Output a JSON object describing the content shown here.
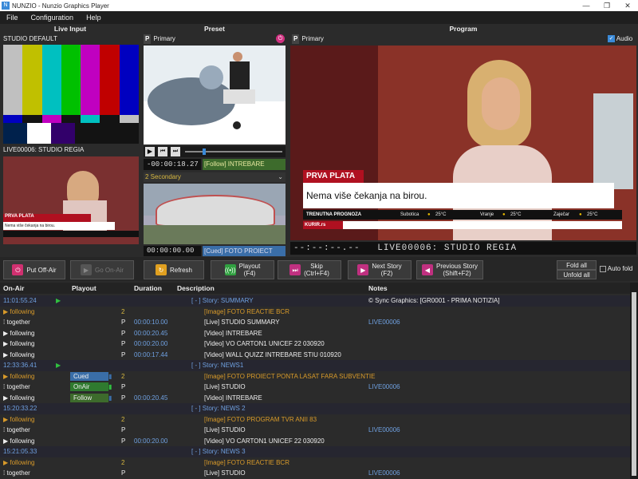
{
  "window": {
    "title": "NUNZIO - Nunzio Graphics Player",
    "minimize": "—",
    "maximize": "❐",
    "close": "✕"
  },
  "menu": [
    "File",
    "Configuration",
    "Help"
  ],
  "columns": {
    "live_input": "Live Input",
    "preset": "Preset",
    "program": "Program"
  },
  "live": {
    "source1": "STUDIO DEFAULT",
    "source2": "LIVE00006: STUDIO REGIA",
    "lower_third_title": "PRVA PLATA",
    "lower_third_text": "Nema više čekanja na birou."
  },
  "preset": {
    "badge": "P",
    "label": "Primary",
    "timecode": "-00:00:18.27",
    "follow_text": "[Follow] INTREBARE",
    "secondary_label": "2 Secondary",
    "timecode2": "00:00:00.00",
    "cued_text": "[Cued] FOTO PROIECT PONTA"
  },
  "program": {
    "badge": "P",
    "label": "Primary",
    "audio_label": "Audio",
    "lower_third_title": "PRVA PLATA",
    "lower_third_text": "Nema više čekanja na birou.",
    "ticker": [
      "TRENUTNA PROGNOZA",
      "Subotica",
      "25°C",
      "Vranje",
      "25°C",
      "Zaječar",
      "25°C"
    ],
    "ticker_site": "KURIR.rs",
    "timecode": "--:--:--.--",
    "live_label": "LIVE00006: STUDIO REGIA"
  },
  "buttons": {
    "put_off_air": "Put Off-Air",
    "go_on_air": "Go On-Air",
    "refresh": "Refresh",
    "playout": "Playout\n(F4)",
    "skip": "Skip\n(Ctrl+F4)",
    "next_story": "Next Story\n(F2)",
    "previous_story": "Previous Story\n(Shift+F2)",
    "fold_all": "Fold all",
    "unfold_all": "Unfold all",
    "auto_fold": "Auto fold"
  },
  "table": {
    "headers": {
      "on_air": "On-Air",
      "playout": "Playout",
      "duration": "Duration",
      "description": "Description",
      "notes": "Notes"
    },
    "rows": [
      {
        "onair": "11:01:55.24",
        "type": "time",
        "play": "▶",
        "pl": "",
        "dur": "",
        "desc": "[ - ] Story: SUMMARY",
        "notes": "© Sync Graphics: [GR0001 - PRIMA NOTIZIA]"
      },
      {
        "onair": "▶ following",
        "type": "orange",
        "pl": "2",
        "dur": "",
        "desc": "[Image] FOTO REACTIE BCR",
        "notes": ""
      },
      {
        "onair": "⁞ together",
        "type": "white",
        "pl": "P",
        "dur": "00:00:10.00",
        "desc": "[Live] STUDIO SUMMARY",
        "notes": "LIVE00006"
      },
      {
        "onair": "▶ following",
        "type": "white",
        "pl": "P",
        "dur": "00:00:20.45",
        "desc": "[Video] INTREBARE",
        "notes": ""
      },
      {
        "onair": "▶ following",
        "type": "white",
        "pl": "P",
        "dur": "00:00:20.00",
        "desc": "[Video] VO CARTON1 UNICEF 22 030920",
        "notes": ""
      },
      {
        "onair": "▶ following",
        "type": "white",
        "pl": "P",
        "dur": "00:00:17.44",
        "desc": "[Video] WALL QUIZZ INTREBARE STIU 010920",
        "notes": ""
      },
      {
        "onair": "12:33:36.41",
        "type": "time",
        "play": "▶",
        "pl": "",
        "dur": "",
        "desc": "[ - ] Story: NEWS1",
        "notes": ""
      },
      {
        "onair": "▶ following",
        "type": "orange",
        "status": "Cued",
        "pl": "2",
        "dur": "",
        "desc": "[Image] FOTO PROIECT PONTA LASAT FARA SUBVENTIE",
        "notes": ""
      },
      {
        "onair": "⁞ together",
        "type": "white",
        "status": "OnAir",
        "pl": "P",
        "dur": "",
        "desc": "[Live] STUDIO",
        "notes": "LIVE00006"
      },
      {
        "onair": "▶ following",
        "type": "white",
        "status": "Follow",
        "pl": "P",
        "dur": "00:00:20.45",
        "desc": "[Video] INTREBARE",
        "notes": ""
      },
      {
        "onair": "15:20:33.22",
        "type": "time",
        "pl": "",
        "dur": "",
        "desc": "[ - ] Story: NEWS 2",
        "notes": ""
      },
      {
        "onair": "▶ following",
        "type": "orange",
        "pl": "2",
        "dur": "",
        "desc": "[Image] FOTO PROGRAM TVR ANII 83",
        "notes": ""
      },
      {
        "onair": "⁞ together",
        "type": "white",
        "pl": "P",
        "dur": "",
        "desc": "[Live] STUDIO",
        "notes": "LIVE00006"
      },
      {
        "onair": "▶ following",
        "type": "white",
        "pl": "P",
        "dur": "00:00:20.00",
        "desc": "[Video] VO CARTON1 UNICEF 22 030920",
        "notes": ""
      },
      {
        "onair": "15:21:05.33",
        "type": "time",
        "pl": "",
        "dur": "",
        "desc": "[ - ] Story: NEWS 3",
        "notes": ""
      },
      {
        "onair": "▶ following",
        "type": "orange",
        "pl": "2",
        "dur": "",
        "desc": "[Image] FOTO REACTIE BCR",
        "notes": ""
      },
      {
        "onair": "⁞ together",
        "type": "white",
        "pl": "P",
        "dur": "",
        "desc": "[Live] STUDIO",
        "notes": "LIVE00006"
      }
    ]
  },
  "colors": {
    "accent": "#3a6ea8",
    "orange": "#d89a2a",
    "time": "#6fa0e0",
    "follow": "#3d6b2c"
  }
}
